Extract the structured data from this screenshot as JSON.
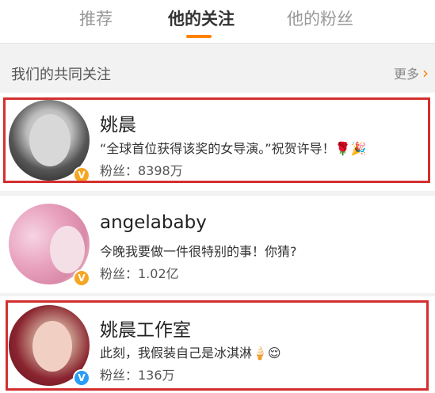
{
  "tabs": [
    {
      "label": "推荐"
    },
    {
      "label": "他的关注"
    },
    {
      "label": "他的粉丝"
    }
  ],
  "common": {
    "title": "我们的共同关注",
    "more": "更多"
  },
  "users": [
    {
      "name": "姚晨",
      "bio": "“全球首位获得该奖的女导演。”祝贺许导！🌹🎉",
      "fans": "粉丝：8398万",
      "verified": "orange"
    },
    {
      "name": "angelababy",
      "bio": "今晚我要做一件很特别的事！你猜?",
      "fans": "粉丝：1.02亿",
      "verified": "orange"
    },
    {
      "name": "姚晨工作室",
      "bio": "此刻，我假装自己是冰淇淋🍦😌",
      "fans": "粉丝：136万",
      "verified": "blue"
    }
  ],
  "colors": {
    "accent": "#ff8200",
    "highlight": "#d32f2f",
    "verify_orange": "#f5a623",
    "verify_blue": "#2a9df4"
  },
  "icons": {
    "more": "chevron-right-icon",
    "verify": "verified-badge-icon"
  }
}
